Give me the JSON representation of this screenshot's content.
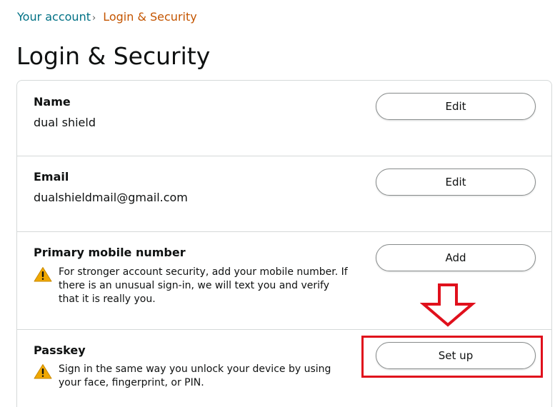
{
  "breadcrumb": {
    "parent": "Your account",
    "separator": "›",
    "current": "Login & Security"
  },
  "page": {
    "title": "Login & Security"
  },
  "rows": {
    "name": {
      "title": "Name",
      "value": "dual shield",
      "button": "Edit"
    },
    "email": {
      "title": "Email",
      "value": "dualshieldmail@gmail.com",
      "button": "Edit"
    },
    "mobile": {
      "title": "Primary mobile number",
      "warning": "For stronger account security, add your mobile number. If there is an unusual sign-in, we will text you and verify that it is really you.",
      "button": "Add"
    },
    "passkey": {
      "title": "Passkey",
      "warning": "Sign in the same way you unlock your device by using your face, fingerprint, or PIN.",
      "button": "Set up"
    }
  },
  "colors": {
    "link": "#007185",
    "breadcrumb_current": "#c45500",
    "warning": "#f0a800",
    "annotation": "#e0101c",
    "border": "#d5d9d9"
  },
  "icons": {
    "warning": "warning-triangle-icon",
    "annotation_arrow": "down-arrow-annotation",
    "breadcrumb_separator": "chevron-right-icon"
  }
}
